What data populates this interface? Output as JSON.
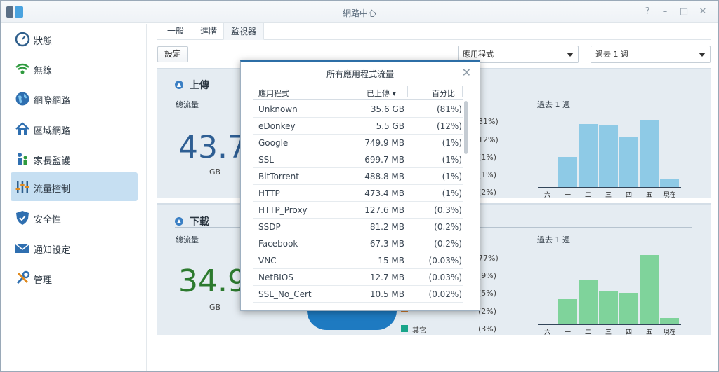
{
  "window": {
    "title": "網路中心",
    "controls": [
      "?",
      "–",
      "□",
      "✕"
    ]
  },
  "sidebar": {
    "items": [
      {
        "label": "狀態",
        "icon": "gauge-icon",
        "active": false
      },
      {
        "label": "無線",
        "icon": "wifi-icon",
        "active": false
      },
      {
        "label": "網際網路",
        "icon": "globe-icon",
        "active": false
      },
      {
        "label": "區域網路",
        "icon": "home-icon",
        "active": false
      },
      {
        "label": "家長監護",
        "icon": "family-icon",
        "active": false
      },
      {
        "label": "流量控制",
        "icon": "sliders-icon",
        "active": true
      },
      {
        "label": "安全性",
        "icon": "shield-icon",
        "active": false
      },
      {
        "label": "通知設定",
        "icon": "envelope-icon",
        "active": false
      },
      {
        "label": "管理",
        "icon": "tools-icon",
        "active": false
      }
    ]
  },
  "tabs": [
    {
      "label": "一般",
      "active": false
    },
    {
      "label": "進階",
      "active": false
    },
    {
      "label": "監視器",
      "active": true
    }
  ],
  "toolbar": {
    "settings_label": "設定",
    "app_select": "應用程式",
    "period_select": "過去 1 週"
  },
  "upload": {
    "title": "上傳",
    "total_label": "總流量",
    "total_value": "43.7",
    "unit": "GB",
    "period_label": "過去 1 週",
    "percents": [
      "31%)",
      "12%)",
      "(1%)",
      "(1%)",
      "(2%)"
    ],
    "bar_color": "#8ecae6",
    "week_labels": [
      "六",
      "一",
      "二",
      "三",
      "四",
      "五",
      "現在"
    ],
    "week_values": [
      0,
      0.43,
      0.9,
      0.88,
      0.72,
      0.96,
      0.11
    ]
  },
  "download": {
    "title": "下載",
    "total_label": "總流量",
    "total_value": "34.9",
    "unit": "GB",
    "period_label": "過去 1 週",
    "percents": [
      "77%)",
      "(9%)",
      "(5%)",
      "(2%)",
      "(3%)"
    ],
    "legend_last": "其它",
    "bar_color": "#7fd39b",
    "week_labels": [
      "六",
      "一",
      "二",
      "三",
      "四",
      "五",
      "現在"
    ],
    "week_values": [
      0,
      0.36,
      0.64,
      0.48,
      0.45,
      1.0,
      0.08
    ]
  },
  "dialog": {
    "title": "所有應用程式流量",
    "columns": {
      "app": "應用程式",
      "uploaded": "已上傳 ▾",
      "percent": "百分比"
    },
    "rows": [
      {
        "app": "Unknown",
        "uploaded": "35.6 GB",
        "percent": "(81%)"
      },
      {
        "app": "eDonkey",
        "uploaded": "5.5 GB",
        "percent": "(12%)"
      },
      {
        "app": "Google",
        "uploaded": "749.9 MB",
        "percent": "(1%)"
      },
      {
        "app": "SSL",
        "uploaded": "699.7 MB",
        "percent": "(1%)"
      },
      {
        "app": "BitTorrent",
        "uploaded": "488.8 MB",
        "percent": "(1%)"
      },
      {
        "app": "HTTP",
        "uploaded": "473.4 MB",
        "percent": "(1%)"
      },
      {
        "app": "HTTP_Proxy",
        "uploaded": "127.6 MB",
        "percent": "(0.3%)"
      },
      {
        "app": "SSDP",
        "uploaded": "81.2 MB",
        "percent": "(0.2%)"
      },
      {
        "app": "Facebook",
        "uploaded": "67.3 MB",
        "percent": "(0.2%)"
      },
      {
        "app": "VNC",
        "uploaded": "15 MB",
        "percent": "(0.03%)"
      },
      {
        "app": "NetBIOS",
        "uploaded": "12.7 MB",
        "percent": "(0.03%)"
      },
      {
        "app": "SSL_No_Cert",
        "uploaded": "10.5 MB",
        "percent": "(0.02%)"
      }
    ]
  }
}
